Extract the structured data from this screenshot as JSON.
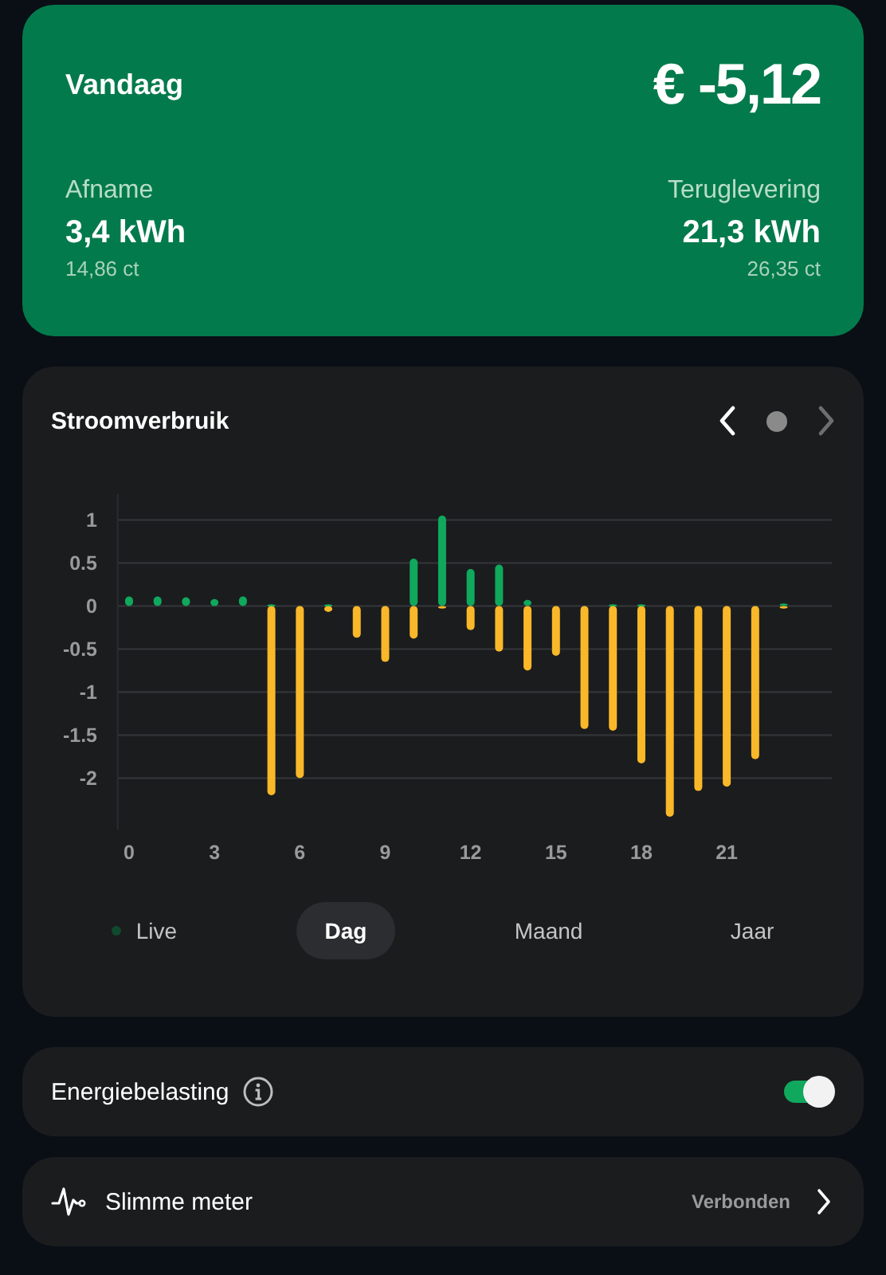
{
  "summary": {
    "title": "Vandaag",
    "total": "€ -5,12",
    "items": [
      {
        "label": "Afname",
        "value": "3,4 kWh",
        "price": "14,86 ct"
      },
      {
        "label": "Teruglevering",
        "value": "21,3 kWh",
        "price": "26,35 ct"
      }
    ]
  },
  "usage": {
    "title": "Stroomverbruik",
    "nav": {
      "prev_disabled": false,
      "next_disabled": true
    },
    "chart_data": {
      "type": "bar",
      "stacked": true,
      "x": [
        0,
        1,
        2,
        3,
        4,
        5,
        6,
        7,
        8,
        9,
        10,
        11,
        12,
        13,
        14,
        15,
        16,
        17,
        18,
        19,
        20,
        21,
        22,
        23
      ],
      "grid": true,
      "ylim": [
        -2.6,
        1.3
      ],
      "xlim": [
        -0.4,
        24.7
      ],
      "yticks": [
        1,
        0.5,
        0,
        -0.5,
        -1,
        -1.5,
        -2
      ],
      "xticks": [
        0,
        3,
        6,
        9,
        12,
        15,
        18,
        21
      ],
      "series": [
        {
          "color": "#0fa85c",
          "values": [
            0.11,
            0.11,
            0.1,
            0.08,
            0.11,
            0.02,
            0,
            0.02,
            0,
            0,
            0.55,
            1.05,
            0.43,
            0.48,
            0.07,
            0,
            0,
            0.02,
            0.02,
            0,
            0,
            0,
            0,
            0.03
          ]
        },
        {
          "color": "#f9b829",
          "values": [
            0,
            0,
            0,
            0,
            0,
            -2.2,
            -2.0,
            -0.07,
            -0.37,
            -0.65,
            -0.38,
            -0.03,
            -0.28,
            -0.53,
            -0.75,
            -0.58,
            -1.43,
            -1.45,
            -1.83,
            -2.45,
            -2.15,
            -2.1,
            -1.78,
            -0.03
          ]
        }
      ]
    },
    "tabs": [
      {
        "label": "Live",
        "kind": "live",
        "selected": false
      },
      {
        "label": "Dag",
        "kind": "period",
        "selected": true
      },
      {
        "label": "Maand",
        "kind": "period",
        "selected": false
      },
      {
        "label": "Jaar",
        "kind": "period",
        "selected": false
      }
    ]
  },
  "settings": [
    {
      "kind": "toggle",
      "label": "Energiebelasting",
      "on": true
    },
    {
      "kind": "link",
      "label": "Slimme meter",
      "status": "Verbonden"
    }
  ]
}
